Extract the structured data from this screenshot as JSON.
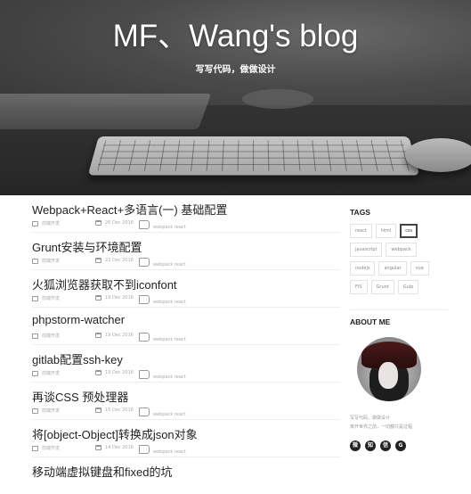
{
  "header": {
    "title": "MF、Wang's blog",
    "subtitle": "写写代码，做做设计"
  },
  "posts": [
    {
      "title": "Webpack+React+多语言(一) 基础配置",
      "category": "前端开发",
      "date": "26 Dec 2016",
      "tags": "webpack react"
    },
    {
      "title": "Grunt安装与环境配置",
      "category": "前端开发",
      "date": "22 Dec 2016",
      "tags": "webpack react"
    },
    {
      "title": "火狐浏览器获取不到iconfont",
      "category": "前端开发",
      "date": "19 Dec 2016",
      "tags": "webpack react"
    },
    {
      "title": "phpstorm-watcher",
      "category": "前端开发",
      "date": "19 Dec 2016",
      "tags": "webpack react"
    },
    {
      "title": "gitlab配置ssh-key",
      "category": "前端开发",
      "date": "19 Dec 2016",
      "tags": "webpack react"
    },
    {
      "title": "再谈CSS 预处理器",
      "category": "前端开发",
      "date": "15 Dec 2016",
      "tags": "webpack react"
    },
    {
      "title": "将[object-Object]转换成json对象",
      "category": "前端开发",
      "date": "14 Dec 2016",
      "tags": "webpack react"
    },
    {
      "title": "移动端虚拟键盘和fixed的坑",
      "category": "",
      "date": "",
      "tags": ""
    }
  ],
  "sidebar": {
    "tags_heading": "TAGS",
    "tags": [
      "react",
      "html",
      "css",
      "javascript",
      "webpack",
      "nodejs",
      "angular",
      "vue",
      "FIS",
      "Grunt",
      "Gulp"
    ],
    "active_tag": "css",
    "about_heading": "ABOUT ME",
    "about_lines": [
      "写写代码，做做设计",
      "离开世界之前，一切都只是过程"
    ],
    "socials": [
      {
        "icon": "weibo-icon",
        "glyph": "微"
      },
      {
        "icon": "zhihu-icon",
        "glyph": "知"
      },
      {
        "icon": "wechat-icon",
        "glyph": "信"
      },
      {
        "icon": "github-icon",
        "glyph": "G"
      }
    ]
  }
}
